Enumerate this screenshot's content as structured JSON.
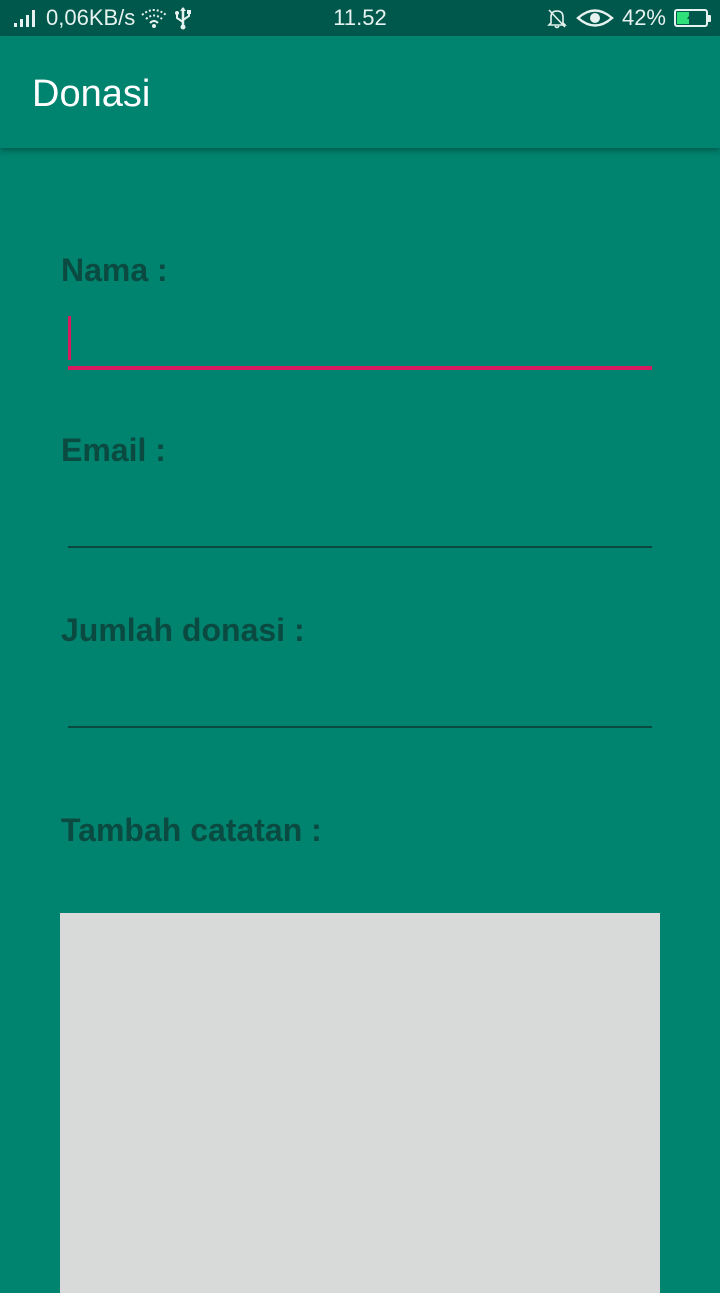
{
  "status_bar": {
    "network_speed": "0,06KB/s",
    "time": "11.52",
    "battery_percent": "42%",
    "battery_level": 0.42,
    "icons": [
      "signal-icon",
      "wifi-icon",
      "usb-icon",
      "bell-muted-icon",
      "eye-icon",
      "battery-charging-icon"
    ]
  },
  "app_bar": {
    "title": "Donasi"
  },
  "form": {
    "name_label": "Nama :",
    "name_value": "",
    "email_label": "Email :",
    "email_value": "",
    "amount_label": "Jumlah donasi :",
    "amount_value": "",
    "notes_label": "Tambah catatan :",
    "notes_value": ""
  },
  "colors": {
    "primary": "#00836F",
    "primary_dark": "#00574B",
    "accent": "#D81B60",
    "label_text": "#0B4A40",
    "notes_background": "#D8DAD9"
  }
}
